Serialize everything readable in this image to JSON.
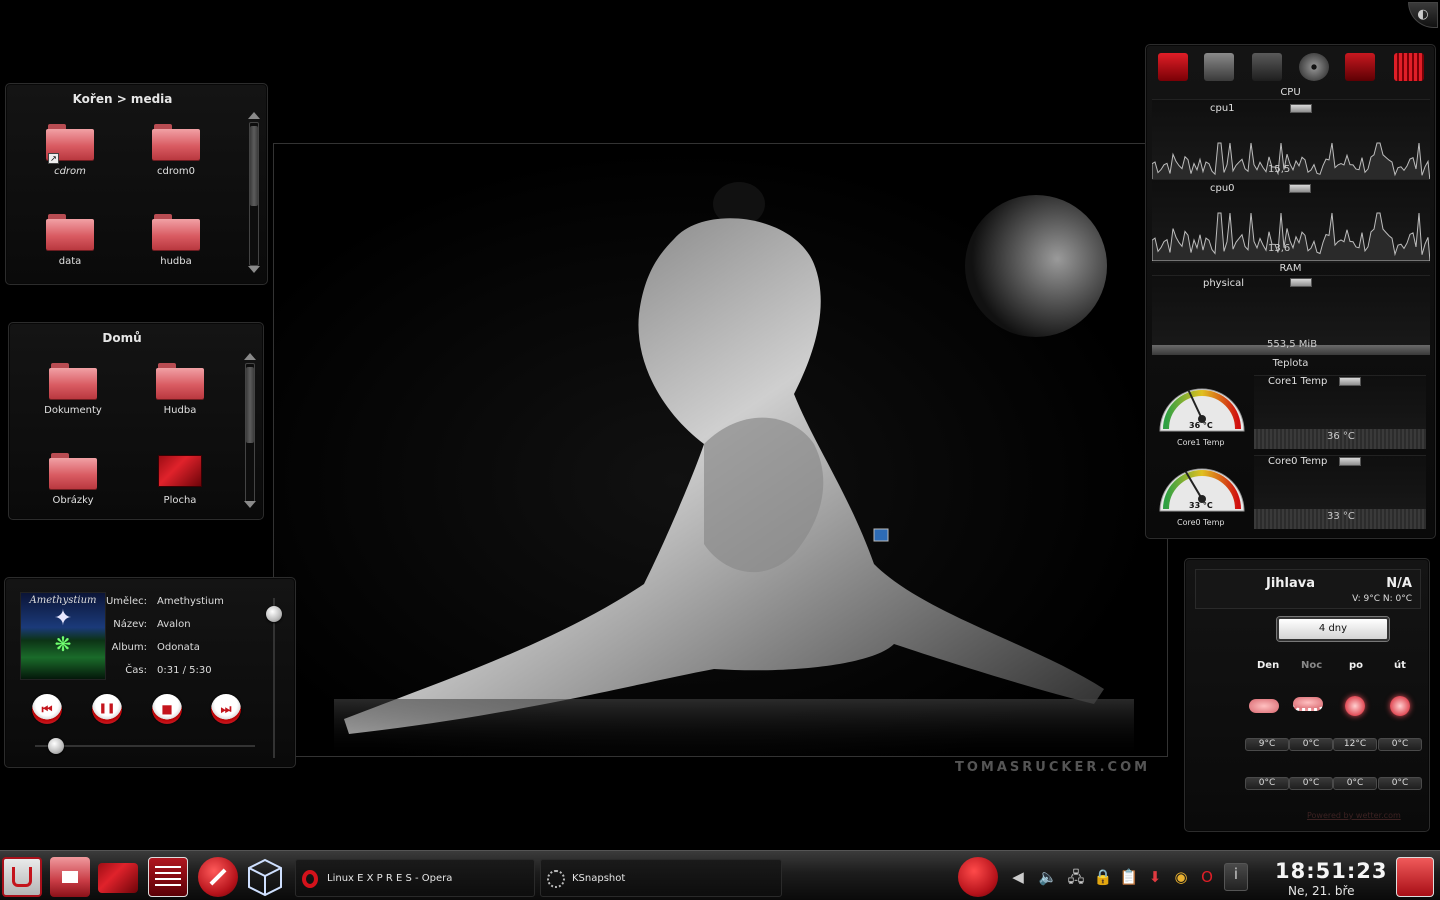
{
  "folder_root": {
    "title": "Kořen > media",
    "items": [
      {
        "label": "cdrom",
        "link": true
      },
      {
        "label": "cdrom0",
        "link": false
      },
      {
        "label": "data",
        "link": false
      },
      {
        "label": "hudba",
        "link": false
      }
    ]
  },
  "folder_home": {
    "title": "Domů",
    "items": [
      {
        "label": "Dokumenty"
      },
      {
        "label": "Hudba"
      },
      {
        "label": "Obrázky"
      },
      {
        "label": "Plocha"
      }
    ]
  },
  "watermark": "TOMASRUCKER.COM",
  "media_player": {
    "cover_title": "Amethystium",
    "rows": [
      {
        "label": "Umělec:",
        "value": "Amethystium"
      },
      {
        "label": "Název:",
        "value": "Avalon"
      },
      {
        "label": "Album:",
        "value": "Odonata"
      },
      {
        "label": "Čas:",
        "value": "0:31 / 5:30"
      }
    ],
    "buttons": {
      "prev": "⏮",
      "pause": "❚❚",
      "stop": "■",
      "next": "⏭"
    },
    "progress_fraction": 0.094,
    "volume_fraction": 0.9
  },
  "sysmon": {
    "cpu": {
      "title": "CPU",
      "cores": [
        {
          "name": "cpu1",
          "value": "15,5",
          "usage_fraction": 0.155
        },
        {
          "name": "cpu0",
          "value": "13,6",
          "usage_fraction": 0.136
        }
      ]
    },
    "ram": {
      "title": "RAM",
      "name": "physical",
      "value": "553,5 MiB"
    },
    "temp": {
      "title": "Teplota",
      "sensors": [
        {
          "name": "Core1 Temp",
          "gauge_value": "36 °C",
          "graph_value": "36 °C",
          "celsius": 36
        },
        {
          "name": "Core0 Temp",
          "gauge_value": "33 °C",
          "graph_value": "33 °C",
          "celsius": 33
        }
      ]
    }
  },
  "weather": {
    "city": "Jihlava",
    "current": "N/A",
    "hi_lo": "V: 9°C N: 0°C",
    "button": "4 dny",
    "columns": [
      "Den",
      "Noc",
      "po",
      "út"
    ],
    "row1": [
      "9°C",
      "0°C",
      "12°C",
      "0°C"
    ],
    "row2": [
      "0°C",
      "0°C",
      "0°C",
      "0°C"
    ],
    "powered_by": "Powered by wetter.com"
  },
  "taskbar": {
    "tasks": [
      {
        "label": "Linux E X P R E S - Opera",
        "icon": "opera-icon"
      },
      {
        "label": "KSnapshot",
        "icon": "ksnapshot-icon"
      }
    ],
    "clock": {
      "time": "18:51:23",
      "date": "Ne, 21. bře"
    }
  },
  "colors": {
    "accent": "#c4141c",
    "panel_bg": "#111111"
  }
}
